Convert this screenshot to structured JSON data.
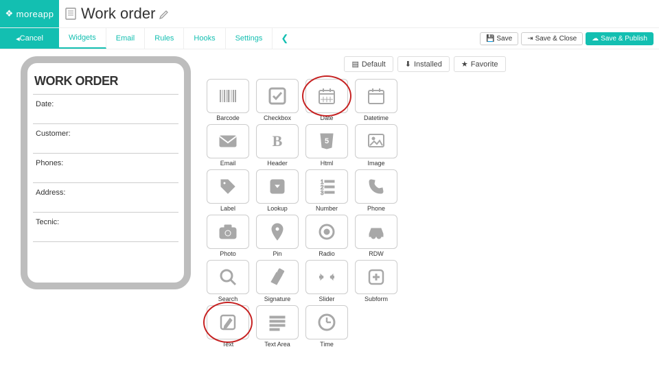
{
  "brand": "moreapp",
  "page_title": "Work order",
  "tabbar": {
    "cancel": "Cancel",
    "tabs": [
      "Widgets",
      "Email",
      "Rules",
      "Hooks",
      "Settings"
    ]
  },
  "actions": {
    "save": "Save",
    "save_close": "Save & Close",
    "save_publish": "Save & Publish"
  },
  "form": {
    "title": "WORK ORDER",
    "fields": [
      "Date:",
      "Customer:",
      "Phones:",
      "Address:",
      "Tecnic:"
    ]
  },
  "filters": [
    "Default",
    "Installed",
    "Favorite"
  ],
  "widgets": [
    {
      "label": "Barcode",
      "icon": "barcode"
    },
    {
      "label": "Checkbox",
      "icon": "checkbox"
    },
    {
      "label": "Date",
      "icon": "date",
      "circled": true
    },
    {
      "label": "Datetime",
      "icon": "datetime"
    },
    {
      "label": "Email",
      "icon": "email"
    },
    {
      "label": "Header",
      "icon": "header"
    },
    {
      "label": "Html",
      "icon": "html"
    },
    {
      "label": "Image",
      "icon": "image"
    },
    {
      "label": "Label",
      "icon": "label"
    },
    {
      "label": "Lookup",
      "icon": "lookup"
    },
    {
      "label": "Number",
      "icon": "number"
    },
    {
      "label": "Phone",
      "icon": "phone"
    },
    {
      "label": "Photo",
      "icon": "photo"
    },
    {
      "label": "Pin",
      "icon": "pin"
    },
    {
      "label": "Radio",
      "icon": "radio"
    },
    {
      "label": "RDW",
      "icon": "rdw"
    },
    {
      "label": "Search",
      "icon": "search"
    },
    {
      "label": "Signature",
      "icon": "signature"
    },
    {
      "label": "Slider",
      "icon": "slider"
    },
    {
      "label": "Subform",
      "icon": "subform"
    },
    {
      "label": "Text",
      "icon": "text",
      "circled": true
    },
    {
      "label": "Text Area",
      "icon": "textarea"
    },
    {
      "label": "Time",
      "icon": "time"
    }
  ]
}
